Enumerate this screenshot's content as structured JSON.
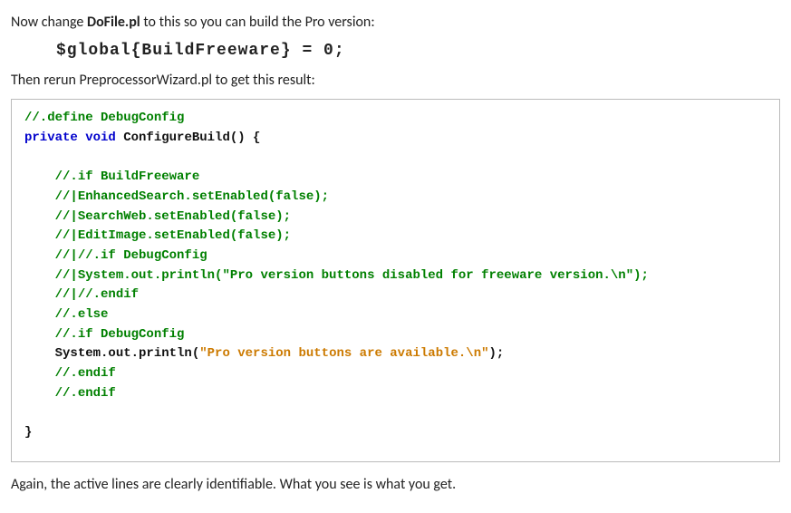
{
  "para1_pre": "Now change ",
  "para1_bold": "DoFile.pl",
  "para1_post": " to this so you can build the Pro version:",
  "inline_code": "$global{BuildFreeware} = 0;",
  "para2": "Then rerun PreprocessorWizard.pl to get this result:",
  "code": {
    "l0": "//.define DebugConfig",
    "kw_private": "private",
    "kw_void": "void",
    "fn_sig_rest": " ConfigureBuild() {",
    "blk": {
      "a": "//.if BuildFreeware",
      "b": "//|EnhancedSearch.setEnabled(false);",
      "c": "//|SearchWeb.setEnabled(false);",
      "d": "//|EditImage.setEnabled(false);",
      "e": "//|//.if DebugConfig",
      "f": "//|System.out.println(\"Pro version buttons disabled for freeware version.\\n\");",
      "g": "//|//.endif",
      "h": "//.else",
      "i": "//.if DebugConfig",
      "j_pre": "System.out.println(",
      "j_str": "\"Pro version buttons are available.\\n\"",
      "j_post": ");",
      "k": "//.endif",
      "l": "//.endif"
    },
    "close": "}"
  },
  "para3": "Again, the active lines are clearly identifiable.  What you see is what you get."
}
